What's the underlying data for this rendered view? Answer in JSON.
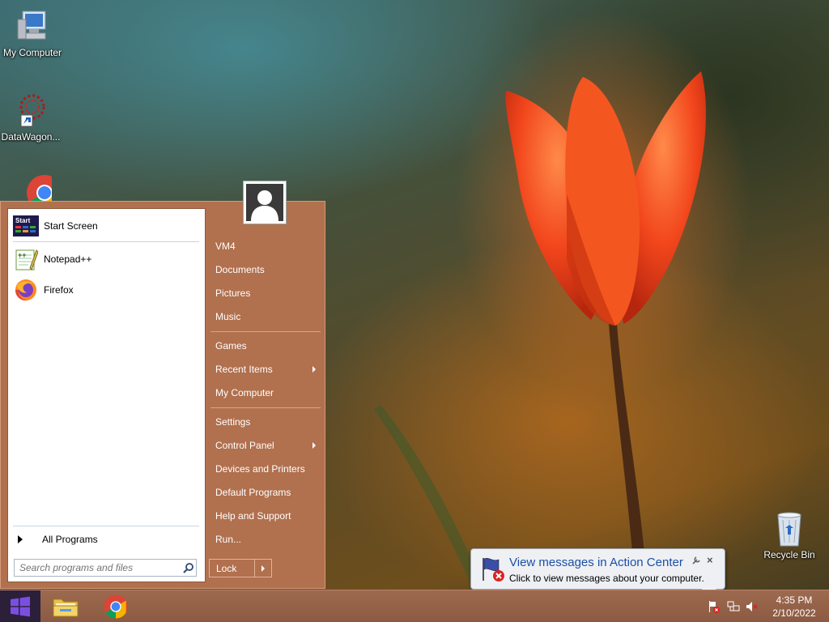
{
  "desktop": {
    "icons": [
      {
        "label": "My Computer"
      },
      {
        "label": "DataWagon..."
      },
      {
        "label": "Recycle Bin"
      }
    ]
  },
  "start_menu": {
    "pinned": [
      {
        "label": "Start Screen",
        "icon": "start-screen-icon"
      },
      {
        "label": "Notepad++",
        "icon": "notepadpp-icon"
      },
      {
        "label": "Firefox",
        "icon": "firefox-icon"
      }
    ],
    "all_programs": "All Programs",
    "search_placeholder": "Search programs and files",
    "right_items": [
      {
        "label": "VM4"
      },
      {
        "label": "Documents"
      },
      {
        "label": "Pictures"
      },
      {
        "label": "Music"
      },
      {
        "label": "Games"
      },
      {
        "label": "Recent Items"
      },
      {
        "label": "My Computer"
      },
      {
        "label": "Settings"
      },
      {
        "label": "Control Panel"
      },
      {
        "label": "Devices and Printers"
      },
      {
        "label": "Default Programs"
      },
      {
        "label": "Help and Support"
      },
      {
        "label": "Run..."
      }
    ],
    "lock_label": "Lock"
  },
  "notification": {
    "title": "View messages in Action Center",
    "body": "Click to view messages about your computer."
  },
  "taskbar": {
    "clock_time": "4:35 PM",
    "clock_date": "2/10/2022"
  },
  "colors": {
    "start_menu_bg": "#b1704e",
    "taskbar_bg": "#9d6a50",
    "start_button_bg": "#2c1f3a",
    "notification_title": "#1b4fa6"
  }
}
